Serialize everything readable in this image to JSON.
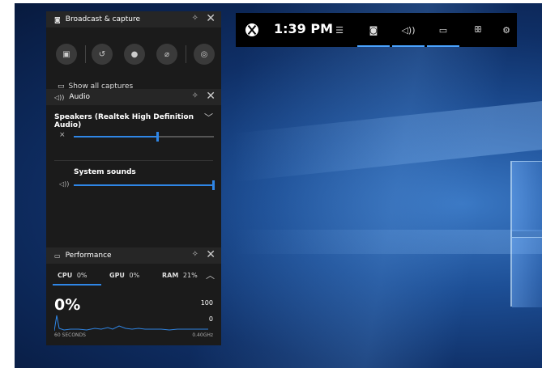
{
  "topbar": {
    "clock": "1:39 PM",
    "items": [
      "widget-menu-icon",
      "broadcast-capture-icon",
      "audio-icon",
      "performance-icon",
      "looking-for-group-icon",
      "settings-icon"
    ]
  },
  "broadcast": {
    "title": "Broadcast & capture",
    "show_all": "Show all captures",
    "buttons": [
      "camera-icon",
      "record-last-icon",
      "record-icon",
      "mic-off-icon",
      "broadcast-icon"
    ]
  },
  "audio": {
    "title": "Audio",
    "device": "Speakers (Realtek High Definition Audio)",
    "master_level": 0.6,
    "system_sounds_label": "System sounds",
    "system_sounds_level": 1.0
  },
  "performance": {
    "title": "Performance",
    "tabs": [
      {
        "name": "CPU",
        "value": "0%"
      },
      {
        "name": "GPU",
        "value": "0%"
      },
      {
        "name": "RAM",
        "value": "21%"
      }
    ],
    "current": "0%",
    "ymax": "100",
    "ymin": "0",
    "footer_left": "60 SECONDS",
    "footer_right": "0.40GHz",
    "accent": "#2f86e6"
  }
}
